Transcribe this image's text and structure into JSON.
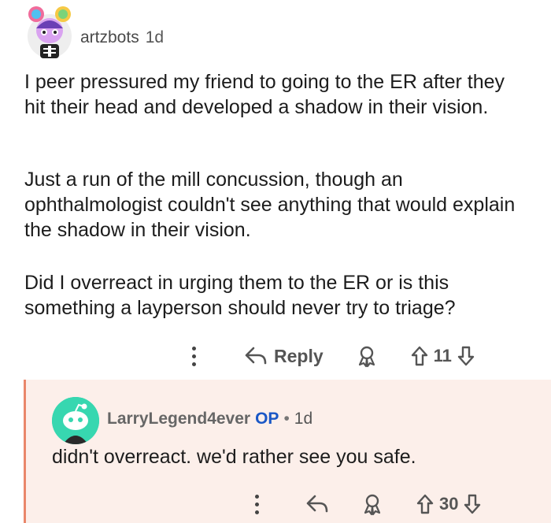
{
  "comment": {
    "username": "artzbots",
    "age": "1d",
    "paragraphs": [
      "I peer pressured my friend to going to the ER after they hit their head and developed a shadow in their vision.",
      "Just a run of the mill concussion, though an ophthalmologist couldn't see anything that would explain the shadow in their vision.",
      "Did I overreact in urging them to the ER or is this something a layperson should never try to triage?"
    ],
    "actions": {
      "more_icon": "more-vertical-icon",
      "reply_label": "Reply",
      "award_icon": "award-icon",
      "score": "11"
    }
  },
  "reply": {
    "username": "LarryLegend4ever",
    "op_badge": "OP",
    "separator": "•",
    "age": "1d",
    "text": "didn't overreact. we'd rather see you safe.",
    "actions": {
      "more_icon": "more-vertical-icon",
      "reply_icon": "reply-arrow-icon",
      "award_icon": "award-icon",
      "score": "30"
    }
  },
  "colors": {
    "reply_background": "#fcefea",
    "reply_border": "#e9866a",
    "op_badge": "#1a57c6",
    "reply_avatar": "#37d7b0"
  }
}
